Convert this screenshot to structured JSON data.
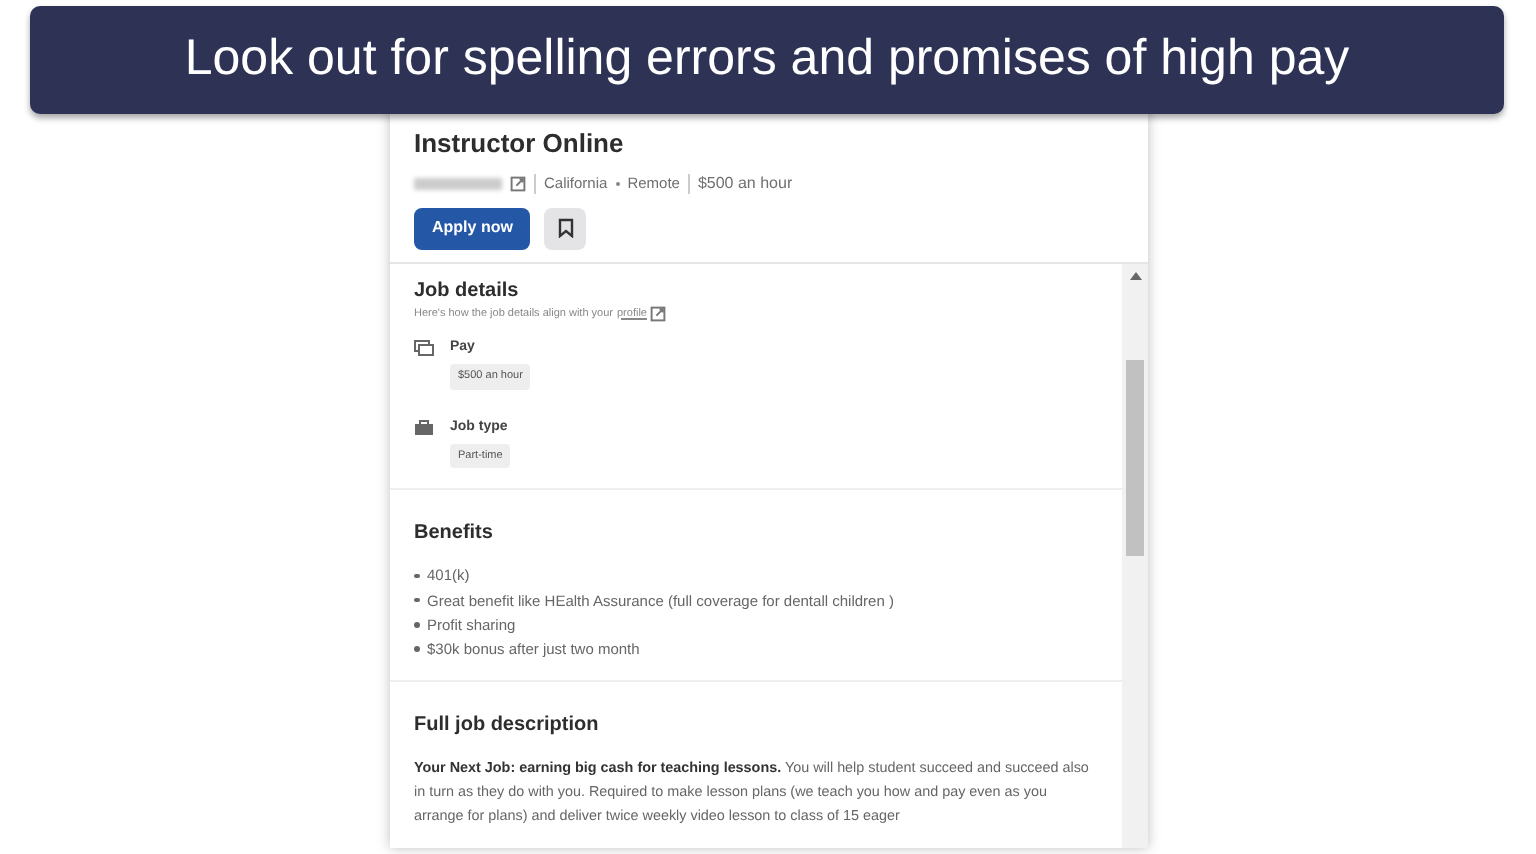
{
  "banner": {
    "text": "Look out for spelling errors and promises of high pay"
  },
  "job": {
    "title": "Instructor Online",
    "location": "California",
    "work_mode": "Remote",
    "pay": "$500 an hour",
    "apply_button": "Apply now"
  },
  "details": {
    "heading": "Job details",
    "subtitle": "Here's how the job details align with your",
    "subtitle_link": "profile",
    "items": [
      {
        "kind": "pay",
        "label": "Pay",
        "tag": "$500 an hour"
      },
      {
        "kind": "job_type",
        "label": "Job type",
        "tag": "Part-time"
      }
    ]
  },
  "benefits": {
    "heading": "Benefits",
    "items": [
      "401(k)",
      "Great benefit like HEalth Assurance (full coverage for dentall children )",
      "Profit sharing",
      "$30k bonus after just two month"
    ]
  },
  "description": {
    "heading": "Full job description",
    "text": "**Your Next Job: earning big cash for teaching lessons.** You will help student succeed and succeed also in turn as they do with you. Required to make lesson plans (we teach you how and pay even as you arrange for plans) and deliver twice weekly video lesson to class of 15 eager"
  }
}
